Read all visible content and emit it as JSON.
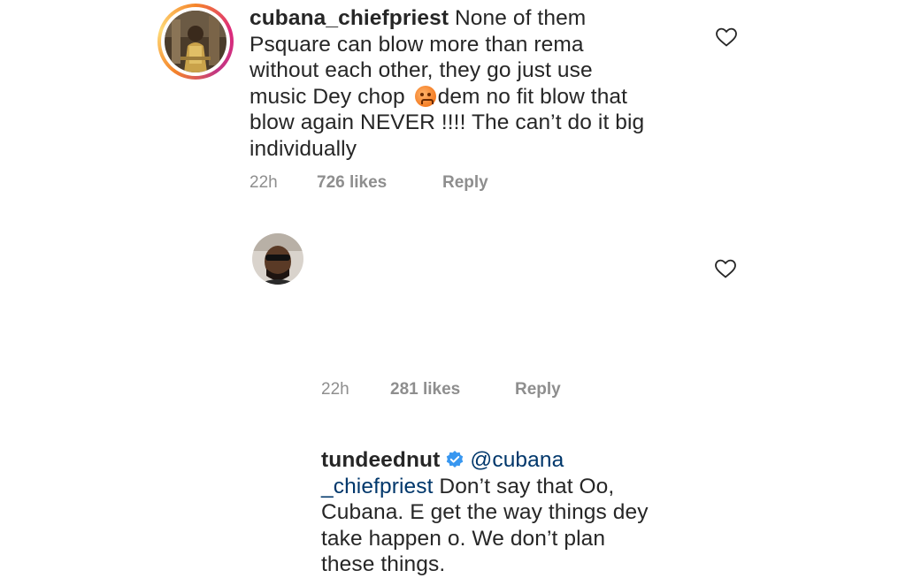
{
  "comments": [
    {
      "username": "cubana_chiefpriest",
      "lines": [
        " None of them",
        "Psquare can blow more than rema",
        "without each other, they go just use",
        "music Dey chop ",
        "dem no fit blow that",
        "blow again NEVER !!!! The can’t do it big",
        "individually"
      ],
      "emoji": "weary-face-emoji",
      "time": "22h",
      "likes": "726 likes",
      "reply_label": "Reply",
      "has_story_ring": true
    },
    {
      "username": "tundeednut",
      "verified": true,
      "mention_part1": "@cubana",
      "mention_part2": "_chiefpriest",
      "lines": [
        " Don’t say that Oo,",
        "Cubana. E get the way things dey",
        "take happen o. We don’t plan",
        "these things."
      ],
      "time": "22h",
      "likes": "281 likes",
      "reply_label": "Reply",
      "has_story_ring": false
    }
  ],
  "icons": {
    "like": "heart-outline-icon",
    "verified": "verified-badge-icon"
  },
  "colors": {
    "text": "#262626",
    "meta": "#8e8e8e",
    "mention": "#00376b",
    "verified": "#3897f0"
  }
}
